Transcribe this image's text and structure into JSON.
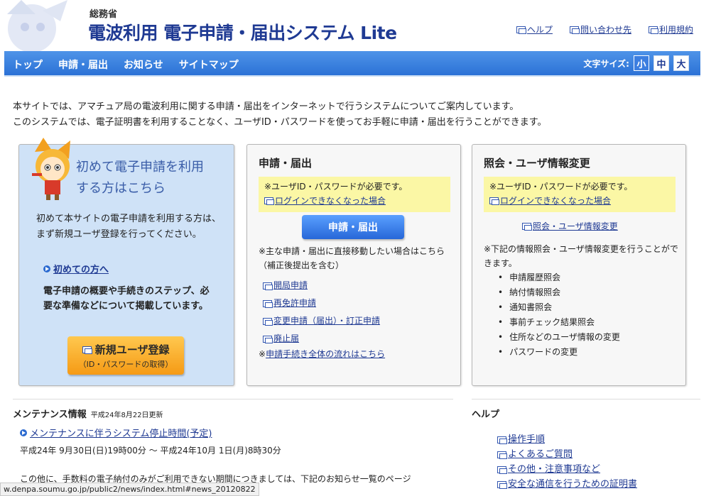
{
  "header": {
    "ministry": "総務省",
    "title": "電波利用 電子申請・届出システム Lite",
    "links": [
      "ヘルプ",
      "問い合わせ先",
      "利用規約"
    ]
  },
  "nav": {
    "items": [
      "トップ",
      "申請・届出",
      "お知らせ",
      "サイトマップ"
    ],
    "font_size_label": "文字サイズ:",
    "font_sizes": [
      "小",
      "中",
      "大"
    ]
  },
  "intro": {
    "line1": "本サイトでは、アマチュア局の電波利用に関する申請・届出をインターネットで行うシステムについてご案内しています。",
    "line2": "このシステムでは、電子証明書を利用することなく、ユーザID・パスワードを使ってお手軽に申請・届出を行うことができます。"
  },
  "panel_first": {
    "title_line1": "初めて電子申請を利用",
    "title_line2": "する方はこちら",
    "text": "初めて本サイトの電子申請を利用する方は、まず新規ユーザ登録を行ってください。",
    "first_link": "初めての方へ",
    "text2": "電子申請の概要や手続きのステップ、必要な準備などについて掲載しています。",
    "button_line1": "新規ユーザ登録",
    "button_line2": "（ID・パスワードの取得）"
  },
  "panel_apply": {
    "title": "申請・届出",
    "notice": "※ユーザID・パスワードが必要です。",
    "login_link": "ログインできなくなった場合",
    "button": "申請・届出",
    "note": "※主な申請・届出に直接移動したい場合はこちら（補正後提出を含む）",
    "links": [
      "開局申請",
      "再免許申請",
      "変更申請（届出）・訂正申請",
      "廃止届"
    ],
    "flow_prefix": "※",
    "flow_link": "申請手続き全体の流れはこちら"
  },
  "panel_inquiry": {
    "title": "照会・ユーザ情報変更",
    "notice": "※ユーザID・パスワードが必要です。",
    "login_link": "ログインできなくなった場合",
    "link": "照会・ユーザ情報変更",
    "note": "※下記の情報照会・ユーザ情報変更を行うことができます。",
    "items": [
      "申請履歴照会",
      "納付情報照会",
      "通知書照会",
      "事前チェック結果照会",
      "住所などのユーザ情報の変更",
      "パスワードの変更"
    ]
  },
  "maintenance": {
    "title": "メンテナンス情報",
    "date": "平成24年8月22日更新",
    "link": "メンテナンスに伴うシステム停止時間(予定)",
    "time": "平成24年 9月30日(日)19時00分 ～ 平成24年10月 1日(月)8時30分",
    "more": "この他に、手数料の電子納付のみがご利用できない期間につきましては、下記のお知らせ一覧のページ"
  },
  "help": {
    "title": "ヘルプ",
    "links": [
      "操作手順",
      "よくあるご質問",
      "その他・注意事項など",
      "安全な通信を行うための証明書"
    ]
  },
  "status_bar": "w.denpa.soumu.go.jp/public2/news/index.html#news_20120822",
  "colors": {
    "accent": "#1f3a93",
    "nav": "#2b71d6",
    "panel_blue": "#cfe2f7",
    "highlight": "#fbf7a5",
    "orange": "#f59a15"
  }
}
